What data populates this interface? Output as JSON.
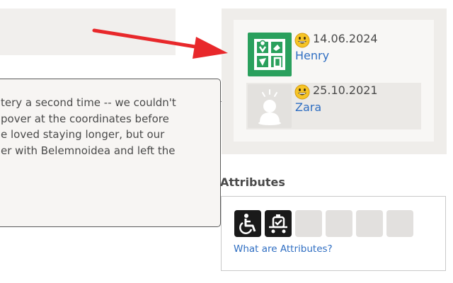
{
  "log_popup": {
    "lines": [
      "tery a second time -- we couldn't",
      "pover at the coordinates before",
      "e loved staying longer, but our",
      "er with Belemnoidea and left the"
    ]
  },
  "logs": [
    {
      "date": "14.06.2024",
      "user": "Henry",
      "avatar_icon": "geocaching-logo-icon",
      "emoji": "grinning-face-icon",
      "avatar_bg": "#2aa05d"
    },
    {
      "date": "25.10.2021",
      "user": "Zara",
      "avatar_icon": "default-avatar-icon",
      "emoji": "grinning-face-icon",
      "avatar_bg": "#e3e1de"
    }
  ],
  "attributes": {
    "title": "Attributes",
    "link": "What are Attributes?",
    "icons": [
      "wheelchair-accessible-icon",
      "stroller-accessible-icon"
    ]
  },
  "colors": {
    "arrow": "#e8282b",
    "link": "#2f6ec2",
    "panel_bg": "#efedea"
  }
}
